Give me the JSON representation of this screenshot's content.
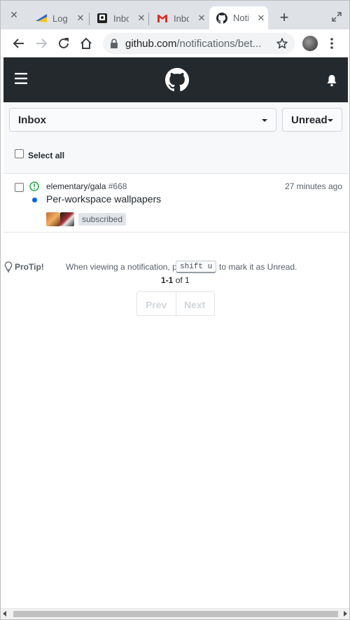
{
  "browser": {
    "tabs": [
      {
        "label": "Log",
        "icon": "yellow-blue-favicon"
      },
      {
        "label": "Inbo",
        "icon": "inbox-favicon"
      },
      {
        "label": "Inbo",
        "icon": "gmail-favicon"
      },
      {
        "label": "Noti",
        "icon": "github-favicon",
        "active": true
      }
    ],
    "url_host": "github.com",
    "url_path": "/notifications/bet..."
  },
  "header": {
    "icons": [
      "hamburger-icon",
      "github-octocat-icon",
      "bell-icon"
    ]
  },
  "filters": {
    "inbox_label": "Inbox",
    "unread_label": "Unread"
  },
  "select_all_label": "Select all",
  "notifications": [
    {
      "repo": "elementary/gala",
      "number": "#668",
      "time": "27 minutes ago",
      "title": "Per-workspace wallpapers",
      "reason": "subscribed"
    }
  ],
  "protip": {
    "label": "ProTip!",
    "text_before": "When viewing a notification, press",
    "key": "shift u",
    "text_after": "to mark it as Unread."
  },
  "pagination": {
    "range": "1-1",
    "of_text": "of 1",
    "prev_label": "Prev",
    "next_label": "Next"
  },
  "colors": {
    "header_bg": "#24292e",
    "unread_dot": "#0366d6",
    "open_issue": "#28a745"
  }
}
